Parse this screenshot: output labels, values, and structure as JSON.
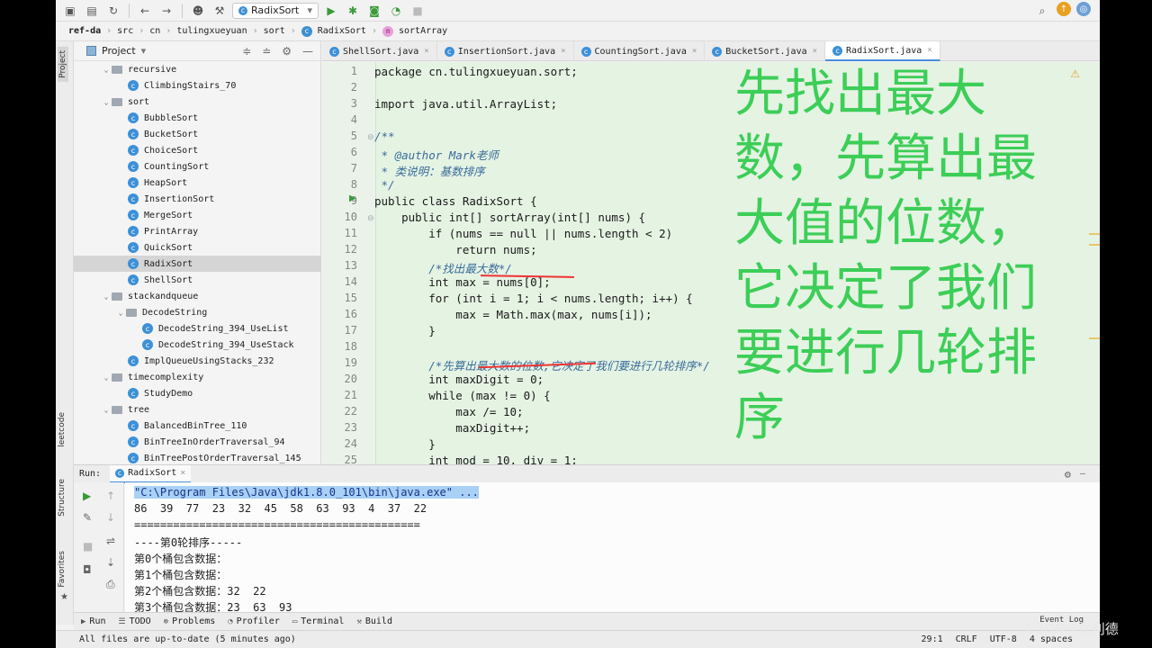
{
  "toolbar": {
    "run_config": "RadixSort"
  },
  "breadcrumb": [
    "ref-da",
    "src",
    "cn",
    "tulingxueyuan",
    "sort",
    "RadixSort",
    "sortArray"
  ],
  "left_strip": {
    "project": "Project",
    "leetcode": "leetcode",
    "structure": "Structure",
    "favorites": "Favorites"
  },
  "project_panel": {
    "title": "Project",
    "tree": [
      {
        "label": "recursive",
        "kind": "folder",
        "indent": 1,
        "open": true
      },
      {
        "label": "ClimbingStairs_70",
        "kind": "class",
        "indent": 2
      },
      {
        "label": "sort",
        "kind": "folder",
        "indent": 1,
        "open": true
      },
      {
        "label": "BubbleSort",
        "kind": "class",
        "indent": 2
      },
      {
        "label": "BucketSort",
        "kind": "class",
        "indent": 2
      },
      {
        "label": "ChoiceSort",
        "kind": "class",
        "indent": 2
      },
      {
        "label": "CountingSort",
        "kind": "class",
        "indent": 2
      },
      {
        "label": "HeapSort",
        "kind": "class",
        "indent": 2
      },
      {
        "label": "InsertionSort",
        "kind": "class",
        "indent": 2
      },
      {
        "label": "MergeSort",
        "kind": "class",
        "indent": 2
      },
      {
        "label": "PrintArray",
        "kind": "class",
        "indent": 2
      },
      {
        "label": "QuickSort",
        "kind": "class",
        "indent": 2
      },
      {
        "label": "RadixSort",
        "kind": "class",
        "indent": 2,
        "selected": true
      },
      {
        "label": "ShellSort",
        "kind": "class",
        "indent": 2
      },
      {
        "label": "stackandqueue",
        "kind": "folder",
        "indent": 1,
        "open": true
      },
      {
        "label": "DecodeString",
        "kind": "folder",
        "indent": 2,
        "open": true
      },
      {
        "label": "DecodeString_394_UseList",
        "kind": "class",
        "indent": 3
      },
      {
        "label": "DecodeString_394_UseStack",
        "kind": "class",
        "indent": 3
      },
      {
        "label": "ImplQueueUsingStacks_232",
        "kind": "class",
        "indent": 2
      },
      {
        "label": "timecomplexity",
        "kind": "folder",
        "indent": 1,
        "open": true
      },
      {
        "label": "StudyDemo",
        "kind": "class",
        "indent": 2
      },
      {
        "label": "tree",
        "kind": "folder",
        "indent": 1,
        "open": true
      },
      {
        "label": "BalancedBinTree_110",
        "kind": "class",
        "indent": 2
      },
      {
        "label": "BinTreeInOrderTraversal_94",
        "kind": "class",
        "indent": 2
      },
      {
        "label": "BinTreePostOrderTraversal_145",
        "kind": "class",
        "indent": 2
      }
    ]
  },
  "editor_tabs": [
    {
      "label": "ShellSort.java",
      "active": false
    },
    {
      "label": "InsertionSort.java",
      "active": false
    },
    {
      "label": "CountingSort.java",
      "active": false
    },
    {
      "label": "BucketSort.java",
      "active": false
    },
    {
      "label": "RadixSort.java",
      "active": true
    }
  ],
  "code_lines": [
    "package cn.tulingxueyuan.sort;",
    "",
    "import java.util.ArrayList;",
    "",
    "/**",
    " * @author Mark老师",
    " * 类说明：基数排序",
    " */",
    "public class RadixSort {",
    "    public int[] sortArray(int[] nums) {",
    "        if (nums == null || nums.length < 2)",
    "            return nums;",
    "        /*找出最大数*/",
    "        int max = nums[0];",
    "        for (int i = 1; i < nums.length; i++) {",
    "            max = Math.max(max, nums[i]);",
    "        }",
    "",
    "        /*先算出最大数的位数,它决定了我们要进行几轮排序*/",
    "        int maxDigit = 0;",
    "        while (max != 0) {",
    "            max /= 10;",
    "            maxDigit++;",
    "        }",
    "        int mod = 10, div = 1;"
  ],
  "overlay_text": "先找出最大数，先算出最大值的位数，它决定了我们要进行几轮排序",
  "run_panel": {
    "label": "Run:",
    "tab": "RadixSort",
    "console": [
      "\"C:\\Program Files\\Java\\jdk1.8.0_101\\bin\\java.exe\" ...",
      "86  39  77  23  32  45  58  63  93  4  37  22",
      "============================================",
      "----第0轮排序-----",
      "第0个桶包含数据：",
      "第1个桶包含数据：",
      "第2个桶包含数据：32  22",
      "第3个桶包含数据：23  63  93"
    ]
  },
  "tool_tabs": [
    "Run",
    "TODO",
    "Problems",
    "Profiler",
    "Terminal",
    "Build"
  ],
  "event_log": "Event Log",
  "status": {
    "message": "All files are up-to-date (5 minutes ago)",
    "position": "29:1",
    "line_sep": "CRLF",
    "encoding": "UTF-8",
    "indent": "4 spaces"
  },
  "watermark": "CSDN@优利德"
}
